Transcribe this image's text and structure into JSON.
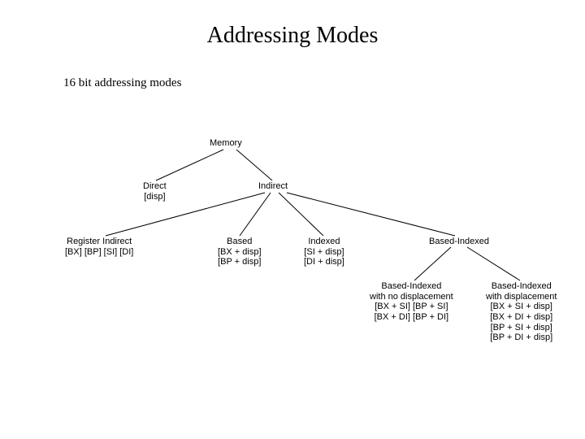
{
  "title": "Addressing Modes",
  "subtitle": "16 bit addressing modes",
  "tree": {
    "root": {
      "label": "Memory"
    },
    "l1": {
      "direct": {
        "label": "Direct",
        "details": [
          "[disp]"
        ]
      },
      "indirect": {
        "label": "Indirect"
      }
    },
    "l2": {
      "regind": {
        "label": "Register Indirect",
        "details": [
          "[BX]  [BP]  [SI]  [DI]"
        ]
      },
      "based": {
        "label": "Based",
        "details": [
          "[BX + disp]",
          "[BP + disp]"
        ]
      },
      "indexed": {
        "label": "Indexed",
        "details": [
          "[SI + disp]",
          "[DI + disp]"
        ]
      },
      "bindex": {
        "label": "Based-Indexed"
      }
    },
    "l3": {
      "bi_nodisp": {
        "label_l1": "Based-Indexed",
        "label_l2": "with no displacement",
        "details": [
          "[BX + SI]   [BP + SI]",
          "[BX + DI]   [BP + DI]"
        ]
      },
      "bi_disp": {
        "label_l1": "Based-Indexed",
        "label_l2": "with displacement",
        "details": [
          "[BX + SI + disp]",
          "[BX + DI + disp]",
          "[BP + SI + disp]",
          "[BP + DI + disp]"
        ]
      }
    }
  }
}
